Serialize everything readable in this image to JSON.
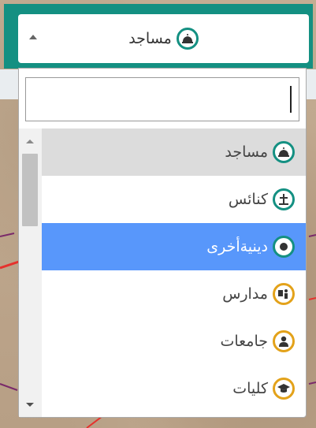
{
  "select": {
    "selected_label": "مساجد",
    "selected_icon": "mosque-icon",
    "frame_color": "#149082"
  },
  "search": {
    "value": "",
    "placeholder": ""
  },
  "options": [
    {
      "label": "مساجد",
      "icon": "mosque-icon",
      "icon_color": "#149082",
      "state": "highlighted"
    },
    {
      "label": "كنائس",
      "icon": "church-icon",
      "icon_color": "#149082",
      "state": "normal"
    },
    {
      "label": "دينيةأخرى",
      "icon": "dot-icon",
      "icon_color": "#149082",
      "state": "selected"
    },
    {
      "label": "مدارس",
      "icon": "school-icon",
      "icon_color": "#e3a21a",
      "state": "normal"
    },
    {
      "label": "جامعات",
      "icon": "university-icon",
      "icon_color": "#e3a21a",
      "state": "normal"
    },
    {
      "label": "كليات",
      "icon": "graduation-cap-icon",
      "icon_color": "#e3a21a",
      "state": "normal"
    }
  ],
  "colors": {
    "selected_bg": "#5897fb",
    "hover_bg": "#dcdcdc"
  }
}
